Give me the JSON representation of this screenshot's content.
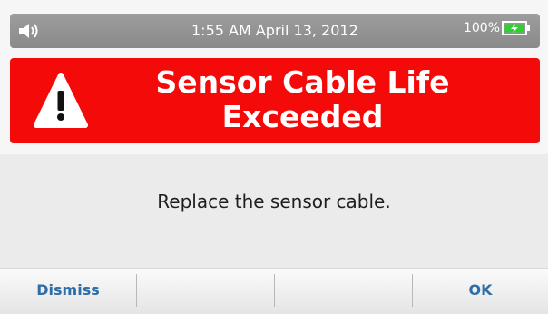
{
  "status_bar": {
    "datetime": "1:55 AM  April 13, 2012",
    "battery_percent": "100%",
    "speaker_icon": "speaker-icon",
    "battery_icon": "battery-icon",
    "battery_color": "#2fd12f"
  },
  "alarm": {
    "title_line1": "Sensor Cable Life",
    "title_line2": "Exceeded",
    "icon": "warning-icon",
    "color": "#f50a0a"
  },
  "message": "Replace the sensor cable.",
  "softkeys": {
    "dismiss_label": "Dismiss",
    "slot2_label": "",
    "slot3_label": "",
    "ok_label": "OK",
    "label_color": "#2f6da6"
  }
}
